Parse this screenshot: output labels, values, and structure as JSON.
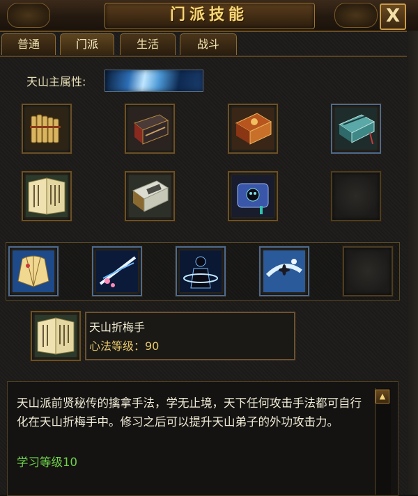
{
  "window": {
    "title": "门派技能",
    "close_label": "X"
  },
  "tabs": [
    {
      "label": "普通",
      "active": false
    },
    {
      "label": "门派",
      "active": true
    },
    {
      "label": "生活",
      "active": false
    },
    {
      "label": "战斗",
      "active": false
    }
  ],
  "attribute": {
    "label": "天山主属性:",
    "icon": "ice-attribute-icon"
  },
  "book_slots_row1": [
    "bamboo-scroll-icon",
    "dark-book-icon",
    "red-book-icon",
    "teal-book-icon"
  ],
  "book_slots_row2": [
    "tianshan-plum-book-icon",
    "white-book-icon",
    "skull-scroll-icon",
    "empty-slot"
  ],
  "skill_slots": [
    "fan-skill-icon",
    "blossom-strike-icon",
    "shadow-whirl-icon",
    "ice-flower-icon",
    "empty-slot"
  ],
  "selected": {
    "icon": "tianshan-plum-book-icon",
    "name": "天山折梅手",
    "level_text": "心法等级：90"
  },
  "description": {
    "text": "天山派前贤秘传的擒拿手法，学无止境，天下任何攻击手法都可自行化在天山折梅手中。修习之后可以提升天山弟子的外功攻击力。",
    "requirement": "学习等级10"
  },
  "colors": {
    "gold": "#f5d77a",
    "green": "#6fd24a",
    "frame": "#6a5128"
  }
}
